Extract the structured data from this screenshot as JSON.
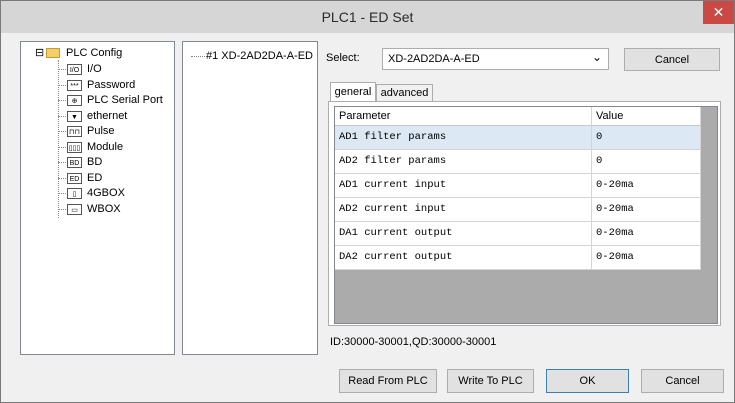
{
  "window": {
    "title": "PLC1 - ED  Set",
    "close_glyph": "✕"
  },
  "tree": {
    "root": {
      "label": "PLC Config",
      "expander": "⊟"
    },
    "items": [
      {
        "label": "I/O",
        "icon": "io-icon",
        "glyph": "I/O"
      },
      {
        "label": "Password",
        "icon": "password-icon",
        "glyph": "***"
      },
      {
        "label": "PLC Serial Port",
        "icon": "serial-port-icon",
        "glyph": "⊕"
      },
      {
        "label": "ethernet",
        "icon": "ethernet-icon",
        "glyph": "▼"
      },
      {
        "label": "Pulse",
        "icon": "pulse-icon",
        "glyph": "⊓⊓"
      },
      {
        "label": "Module",
        "icon": "module-icon",
        "glyph": "▯▯▯"
      },
      {
        "label": "BD",
        "icon": "bd-icon",
        "glyph": "BD"
      },
      {
        "label": "ED",
        "icon": "ed-icon",
        "glyph": "ED"
      },
      {
        "label": "4GBOX",
        "icon": "4gbox-icon",
        "glyph": "▯"
      },
      {
        "label": "WBOX",
        "icon": "wbox-icon",
        "glyph": "▭"
      }
    ]
  },
  "modules_list": {
    "items": [
      "#1 XD-2AD2DA-A-ED"
    ]
  },
  "select": {
    "label": "Select:",
    "value": "XD-2AD2DA-A-ED",
    "arrow": "⌄",
    "cancel_label": "Cancel"
  },
  "tabs": [
    {
      "label": "general",
      "active": true
    },
    {
      "label": "advanced",
      "active": false
    }
  ],
  "table": {
    "columns": [
      "Parameter",
      "Value"
    ],
    "rows": [
      {
        "param": "AD1 filter params",
        "value": "0",
        "selected": true
      },
      {
        "param": "AD2 filter params",
        "value": "0",
        "selected": false
      },
      {
        "param": "AD1 current input",
        "value": "0-20ma",
        "selected": false
      },
      {
        "param": "AD2 current input",
        "value": "0-20ma",
        "selected": false
      },
      {
        "param": "DA1 current output",
        "value": "0-20ma",
        "selected": false
      },
      {
        "param": "DA2 current output",
        "value": "0-20ma",
        "selected": false
      }
    ]
  },
  "status_text": "ID:30000-30001,QD:30000-30001",
  "buttons": {
    "read": "Read From PLC",
    "write": "Write To PLC",
    "ok": "OK",
    "cancel": "Cancel"
  },
  "colors": {
    "selected_row": "#dce8f4",
    "close_button": "#c94a45",
    "titlebar": "#d6d6d6"
  }
}
